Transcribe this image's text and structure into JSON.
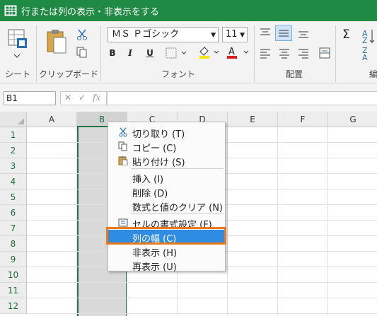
{
  "window": {
    "title": "行または列の表示・非表示をする",
    "accent": "#1e8a43"
  },
  "ribbon": {
    "groups": {
      "sheet": "シート",
      "clipboard": "クリップボード",
      "font": "フォント",
      "alignment": "配置",
      "editing_partial": "編"
    },
    "font_name": "ＭＳ Ｐゴシック",
    "font_size": "11",
    "bold_label": "B",
    "italic_label": "I",
    "underline_label": "U"
  },
  "formula_bar": {
    "name_box": "B1",
    "value": ""
  },
  "grid": {
    "columns": [
      "A",
      "B",
      "C",
      "D",
      "E",
      "F",
      "G"
    ],
    "selected_column": "B",
    "rows": [
      "1",
      "2",
      "3",
      "4",
      "5",
      "6",
      "7",
      "8",
      "9",
      "10",
      "11",
      "12"
    ]
  },
  "context_menu": {
    "items": [
      {
        "label": "切り取り (T)",
        "icon": "scissors-icon",
        "enabled": true
      },
      {
        "label": "コピー (C)",
        "icon": "copy-icon",
        "enabled": true
      },
      {
        "label": "貼り付け (S)",
        "icon": "paste-icon",
        "enabled": true
      },
      {
        "label": "挿入 (I)",
        "icon": "",
        "enabled": true
      },
      {
        "label": "削除 (D)",
        "icon": "",
        "enabled": true
      },
      {
        "label": "数式と値のクリア (N)",
        "icon": "",
        "enabled": true
      },
      {
        "label": "セルの書式設定 (F)",
        "icon": "format-cells-icon",
        "enabled": true
      },
      {
        "label": "列の幅 (C)",
        "icon": "",
        "enabled": true,
        "highlighted": true
      },
      {
        "label": "非表示 (H)",
        "icon": "",
        "enabled": true
      },
      {
        "label": "再表示 (U)",
        "icon": "",
        "enabled": true
      }
    ]
  },
  "colors": {
    "selection_green": "#217346",
    "menu_highlight": "#2e8de3",
    "callout_orange": "#ea7a1d"
  }
}
